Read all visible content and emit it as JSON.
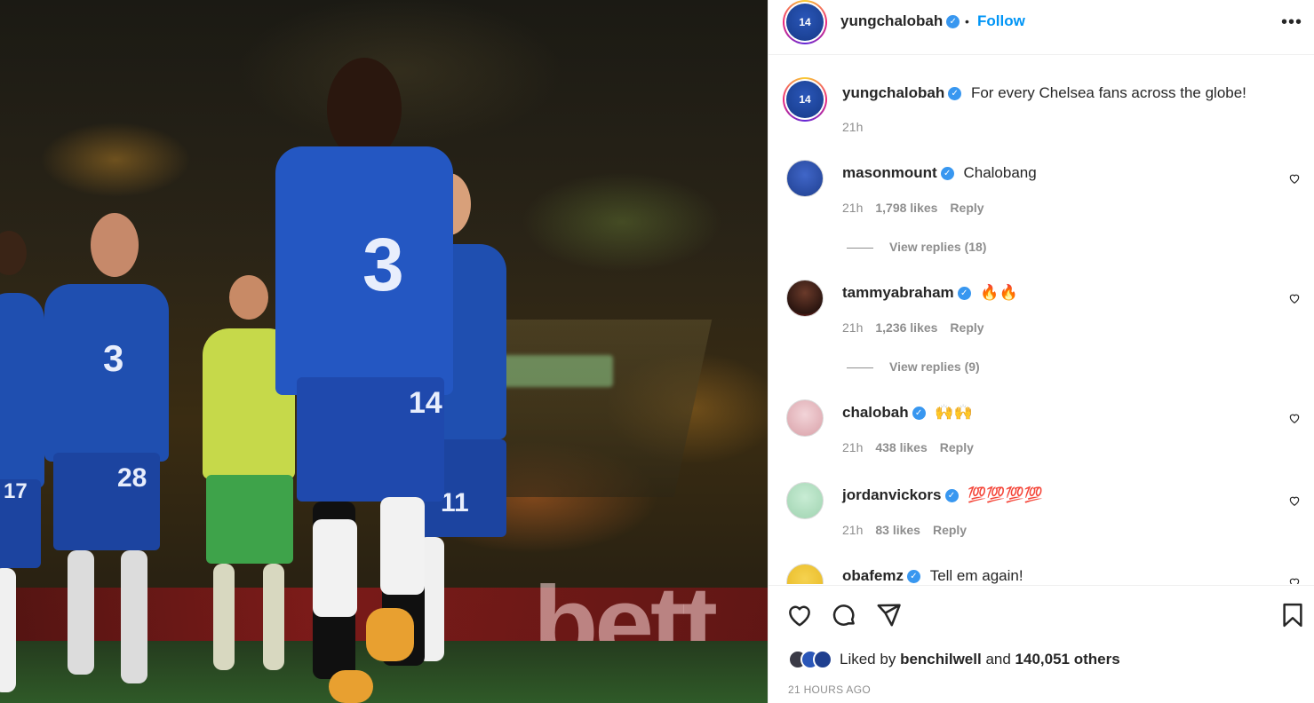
{
  "post": {
    "author": "yungchalobah",
    "follow_label": "Follow",
    "separator": "•",
    "more_label": "•••",
    "caption_user": "yungchalobah",
    "caption_text": "For every Chelsea fans across the globe!",
    "caption_time": "21h",
    "avatar_number": "14"
  },
  "photo": {
    "board_text": "bett",
    "jersey_number_main": "14",
    "jersey_number_left": "28",
    "jersey_number_far_left": "17",
    "jersey_number_back": "11",
    "shirt_sponsor": "3"
  },
  "comments": [
    {
      "user": "masonmount",
      "text": "Chalobang",
      "time": "21h",
      "likes": "1,798 likes",
      "reply": "Reply",
      "view_replies": "View replies (18)",
      "avatar_color": "#1f3f8f"
    },
    {
      "user": "tammyabraham",
      "text": "🔥🔥",
      "time": "21h",
      "likes": "1,236 likes",
      "reply": "Reply",
      "view_replies": "View replies (9)",
      "avatar_color": "#4a2a22"
    },
    {
      "user": "chalobah",
      "text": "🙌🙌",
      "time": "21h",
      "likes": "438 likes",
      "reply": "Reply",
      "view_replies": "",
      "avatar_color": "#d9a0a8"
    },
    {
      "user": "jordanvickors",
      "text": "💯💯💯💯",
      "time": "21h",
      "likes": "83 likes",
      "reply": "Reply",
      "view_replies": "",
      "avatar_color": "#9fd3b0"
    },
    {
      "user": "obafemz",
      "text": "Tell em again!",
      "time": "",
      "likes": "",
      "reply": "",
      "view_replies": "",
      "avatar_color": "#e8b820"
    }
  ],
  "footer": {
    "liked_prefix": "Liked by",
    "liked_user": "benchilwell",
    "liked_and": "and",
    "liked_others": "140,051 others",
    "timestamp": "21 HOURS AGO"
  },
  "icons": {
    "like": "heart-icon",
    "comment": "comment-bubble-icon",
    "share": "paper-plane-icon",
    "save": "bookmark-icon",
    "verified": "verified-badge-icon",
    "more": "more-options-icon"
  },
  "colors": {
    "accent": "#0095f6",
    "verified": "#3897f0",
    "text": "#262626",
    "muted": "#8e8e8e",
    "chelsea_blue": "#1f4fb0",
    "norwich_yellow": "#c6d94a"
  }
}
